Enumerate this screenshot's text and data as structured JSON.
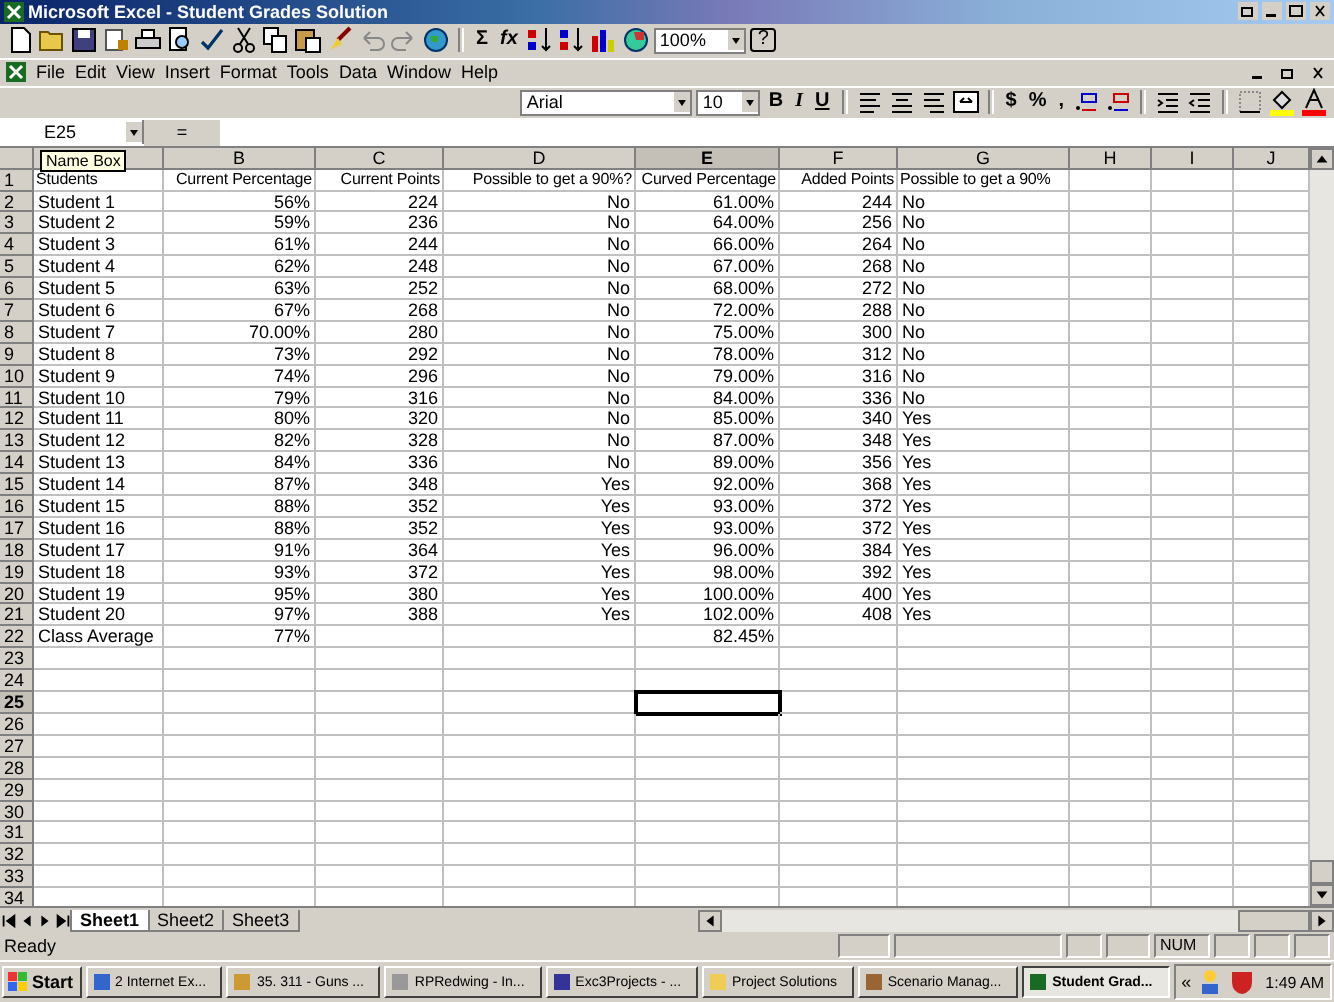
{
  "window": {
    "title": "Microsoft Excel - Student Grades Solution"
  },
  "toolbar": {
    "sum": "Σ",
    "function": "fx",
    "zoom": "100%",
    "help": "?"
  },
  "menu": [
    "File",
    "Edit",
    "View",
    "Insert",
    "Format",
    "Tools",
    "Data",
    "Window",
    "Help"
  ],
  "formatting": {
    "font": "Arial",
    "size": "10",
    "styles": [
      "B",
      "I",
      "U"
    ],
    "number_formats": [
      "$",
      "%",
      ","
    ]
  },
  "formula_bar": {
    "name_box": "E25",
    "equals": "=",
    "tooltip": "Name Box"
  },
  "columns": [
    {
      "kind": "left",
      "selected": false
    },
    {
      "label": "B",
      "kind": "right",
      "selected": false
    },
    {
      "label": "C",
      "kind": "right",
      "selected": false
    },
    {
      "label": "D",
      "kind": "right",
      "selected": false
    },
    {
      "label": "E",
      "kind": "right",
      "selected": true
    },
    {
      "label": "F",
      "kind": "right",
      "selected": false
    },
    {
      "label": "G",
      "kind": "left",
      "selected": false
    },
    {
      "label": "H",
      "kind": "left",
      "selected": false
    },
    {
      "label": "I",
      "kind": "left",
      "selected": false
    },
    {
      "label": "J",
      "kind": "left",
      "selected": false
    }
  ],
  "rows": [
    {
      "number": "1",
      "selected": false,
      "cells": [
        "Students",
        "Current Percentage",
        "Current Points",
        "Possible to get a 90%?",
        "Curved Percentage",
        "Added Points",
        "Possible to get a 90%"
      ]
    },
    {
      "number": "2",
      "selected": false,
      "cells": [
        "Student 1",
        "56%",
        "224",
        "No",
        "61.00%",
        "244",
        "No"
      ]
    },
    {
      "number": "3",
      "selected": false,
      "cells": [
        "Student 2",
        "59%",
        "236",
        "No",
        "64.00%",
        "256",
        "No"
      ]
    },
    {
      "number": "4",
      "selected": false,
      "cells": [
        "Student 3",
        "61%",
        "244",
        "No",
        "66.00%",
        "264",
        "No"
      ]
    },
    {
      "number": "5",
      "selected": false,
      "cells": [
        "Student 4",
        "62%",
        "248",
        "No",
        "67.00%",
        "268",
        "No"
      ]
    },
    {
      "number": "6",
      "selected": false,
      "cells": [
        "Student 5",
        "63%",
        "252",
        "No",
        "68.00%",
        "272",
        "No"
      ]
    },
    {
      "number": "7",
      "selected": false,
      "cells": [
        "Student 6",
        "67%",
        "268",
        "No",
        "72.00%",
        "288",
        "No"
      ]
    },
    {
      "number": "8",
      "selected": false,
      "cells": [
        "Student 7",
        "70.00%",
        "280",
        "No",
        "75.00%",
        "300",
        "No"
      ]
    },
    {
      "number": "9",
      "selected": false,
      "cells": [
        "Student 8",
        "73%",
        "292",
        "No",
        "78.00%",
        "312",
        "No"
      ]
    },
    {
      "number": "10",
      "selected": false,
      "cells": [
        "Student 9",
        "74%",
        "296",
        "No",
        "79.00%",
        "316",
        "No"
      ]
    },
    {
      "number": "11",
      "selected": false,
      "cells": [
        "Student 10",
        "79%",
        "316",
        "No",
        "84.00%",
        "336",
        "No"
      ]
    },
    {
      "number": "12",
      "selected": false,
      "cells": [
        "Student 11",
        "80%",
        "320",
        "No",
        "85.00%",
        "340",
        "Yes"
      ]
    },
    {
      "number": "13",
      "selected": false,
      "cells": [
        "Student 12",
        "82%",
        "328",
        "No",
        "87.00%",
        "348",
        "Yes"
      ]
    },
    {
      "number": "14",
      "selected": false,
      "cells": [
        "Student 13",
        "84%",
        "336",
        "No",
        "89.00%",
        "356",
        "Yes"
      ]
    },
    {
      "number": "15",
      "selected": false,
      "cells": [
        "Student 14",
        "87%",
        "348",
        "Yes",
        "92.00%",
        "368",
        "Yes"
      ]
    },
    {
      "number": "16",
      "selected": false,
      "cells": [
        "Student 15",
        "88%",
        "352",
        "Yes",
        "93.00%",
        "372",
        "Yes"
      ]
    },
    {
      "number": "17",
      "selected": false,
      "cells": [
        "Student 16",
        "88%",
        "352",
        "Yes",
        "93.00%",
        "372",
        "Yes"
      ]
    },
    {
      "number": "18",
      "selected": false,
      "cells": [
        "Student 17",
        "91%",
        "364",
        "Yes",
        "96.00%",
        "384",
        "Yes"
      ]
    },
    {
      "number": "19",
      "selected": false,
      "cells": [
        "Student 18",
        "93%",
        "372",
        "Yes",
        "98.00%",
        "392",
        "Yes"
      ]
    },
    {
      "number": "20",
      "selected": false,
      "cells": [
        "Student 19",
        "95%",
        "380",
        "Yes",
        "100.00%",
        "400",
        "Yes"
      ]
    },
    {
      "number": "21",
      "selected": false,
      "cells": [
        "Student 20",
        "97%",
        "388",
        "Yes",
        "102.00%",
        "408",
        "Yes"
      ]
    },
    {
      "number": "22",
      "selected": false,
      "cells": [
        "Class Average",
        "77%",
        null,
        null,
        "82.45%"
      ]
    },
    {
      "number": "23",
      "selected": false
    },
    {
      "number": "24",
      "selected": false
    },
    {
      "number": "25",
      "selected": true
    },
    {
      "number": "26",
      "selected": false
    },
    {
      "number": "27",
      "selected": false
    },
    {
      "number": "28",
      "selected": false
    },
    {
      "number": "29",
      "selected": false
    },
    {
      "number": "30",
      "selected": false
    },
    {
      "number": "31",
      "selected": false
    },
    {
      "number": "32",
      "selected": false
    },
    {
      "number": "33",
      "selected": false
    },
    {
      "number": "34",
      "selected": false
    }
  ],
  "sheet_tabs": [
    {
      "label": "Sheet1",
      "selected": true
    },
    {
      "label": "Sheet2",
      "selected": false
    },
    {
      "label": "Sheet3",
      "selected": false
    }
  ],
  "status_bar": {
    "status": "Ready",
    "indicator": "NUM"
  },
  "taskbar": {
    "start": "Start",
    "items": [
      {
        "label": "2 Internet Ex...",
        "selected": false
      },
      {
        "label": "35. 311 - Guns ...",
        "selected": false
      },
      {
        "label": "RPRedwing - In...",
        "selected": false
      },
      {
        "label": "Exc3Projects - ...",
        "selected": false
      },
      {
        "label": "Project Solutions",
        "selected": false
      },
      {
        "label": "Scenario Manag...",
        "selected": false
      },
      {
        "label": "Student Grad...",
        "selected": true
      }
    ],
    "tray_toggle": "«",
    "clock": "1:49 AM"
  }
}
